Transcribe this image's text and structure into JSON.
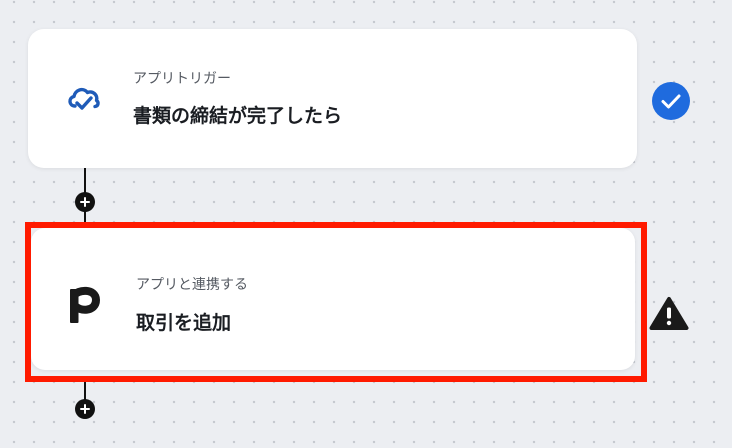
{
  "colors": {
    "canvas_bg": "#eceef2",
    "card_bg": "#ffffff",
    "highlight": "#ff1a00",
    "check_blue": "#1f6bde",
    "trigger_icon_blue": "#1f5bb8"
  },
  "steps": [
    {
      "type_label": "アプリトリガー",
      "title": "書類の締結が完了したら",
      "icon": "cloud-sign-icon",
      "status_icon": "check-circle-icon"
    },
    {
      "type_label": "アプリと連携する",
      "title": "取引を追加",
      "icon": "freee-p-logo-icon",
      "status_icon": "warning-triangle-icon",
      "highlighted": true
    }
  ],
  "add_step_icon": "plus-icon"
}
